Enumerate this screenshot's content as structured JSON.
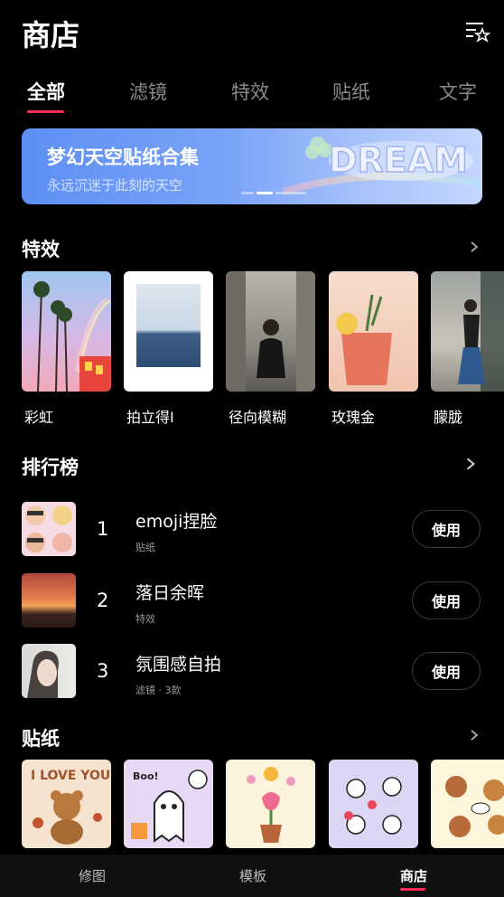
{
  "header": {
    "title": "商店",
    "favorites_icon": "list-star-icon"
  },
  "tabs": [
    {
      "label": "全部",
      "active": true
    },
    {
      "label": "滤镜",
      "active": false
    },
    {
      "label": "特效",
      "active": false
    },
    {
      "label": "贴纸",
      "active": false
    },
    {
      "label": "文字",
      "active": false
    }
  ],
  "banner": {
    "title": "梦幻天空贴纸合集",
    "subtitle": "永远沉迷于此刻的天空",
    "art_text": "DREAM",
    "active_slide": 2,
    "slide_count": 3
  },
  "effects": {
    "title": "特效",
    "items": [
      {
        "label": "彩虹"
      },
      {
        "label": "拍立得I"
      },
      {
        "label": "径向模糊"
      },
      {
        "label": "玫瑰金"
      },
      {
        "label": "朦胧"
      }
    ]
  },
  "ranking": {
    "title": "排行榜",
    "items": [
      {
        "rank": "1",
        "name": "emoji捏脸",
        "category": "贴纸",
        "action": "使用"
      },
      {
        "rank": "2",
        "name": "落日余晖",
        "category": "特效",
        "action": "使用"
      },
      {
        "rank": "3",
        "name": "氛围感自拍",
        "category": "滤镜 · 3款",
        "action": "使用"
      }
    ]
  },
  "stickers": {
    "title": "贴纸",
    "items": [
      {
        "caption": "I LOVE YOU"
      },
      {
        "caption": "Boo!"
      },
      {
        "caption": ""
      },
      {
        "caption": ""
      },
      {
        "caption": ""
      }
    ]
  },
  "bottom_nav": [
    {
      "label": "修图",
      "active": false
    },
    {
      "label": "模板",
      "active": false
    },
    {
      "label": "商店",
      "active": true
    }
  ],
  "colors": {
    "accent": "#ff2d55",
    "background": "#000000",
    "banner": "#6b98f5"
  }
}
